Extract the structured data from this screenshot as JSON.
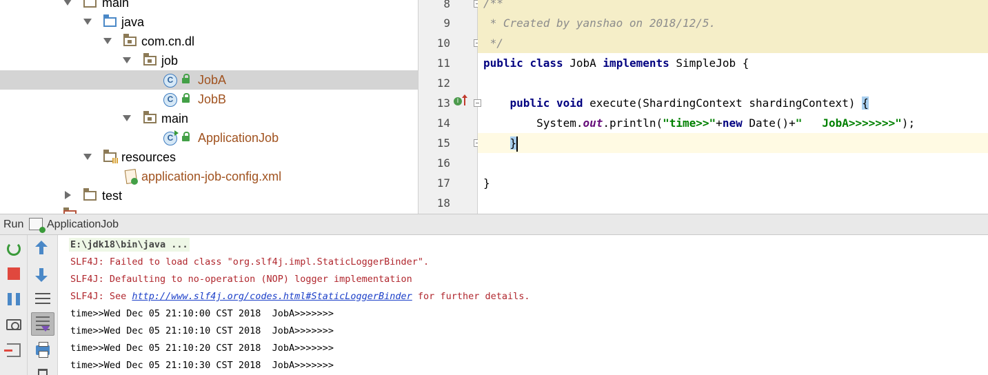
{
  "tree": {
    "items": [
      {
        "label": "main"
      },
      {
        "label": "java"
      },
      {
        "label": "com.cn.dl"
      },
      {
        "label": "job"
      },
      {
        "label": "JobA"
      },
      {
        "label": "JobB"
      },
      {
        "label": "main"
      },
      {
        "label": "ApplicationJob"
      },
      {
        "label": "resources"
      },
      {
        "label": "application-job-config.xml"
      },
      {
        "label": "test"
      }
    ],
    "class_icon_letter": "C"
  },
  "editor": {
    "line_numbers": [
      "8",
      "9",
      "10",
      "11",
      "12",
      "13",
      "14",
      "15",
      "16",
      "17",
      "18"
    ],
    "comment_open": "/**",
    "comment_text": " * Created by yanshao on 2018/12/5.",
    "comment_close": " */",
    "l11_kw1": "public",
    "l11_kw2": "class",
    "l11_name": "JobA",
    "l11_kw3": "implements",
    "l11_iface": "SimpleJob {",
    "l13_kw1": "public",
    "l13_kw2": "void",
    "l13_sig": "execute(ShardingContext shardingContext) ",
    "l13_brace": "{",
    "l14_a": "System.",
    "l14_out": "out",
    "l14_b": ".println(",
    "l14_str1": "\"time>>\"",
    "l14_plus1": "+",
    "l14_new": "new",
    "l14_c": " Date()+",
    "l14_str2": "\"   JobA>>>>>>>\"",
    "l14_end": ");",
    "l15_brace": "}",
    "l17_brace": "}",
    "override_icon": "I"
  },
  "run": {
    "title": "Run",
    "config_name": "ApplicationJob"
  },
  "console": {
    "cmd": "E:\\jdk18\\bin\\java ...",
    "err1": "SLF4J: Failed to load class \"org.slf4j.impl.StaticLoggerBinder\".",
    "err2": "SLF4J: Defaulting to no-operation (NOP) logger implementation",
    "err3_prefix": "SLF4J: See ",
    "err3_link": "http://www.slf4j.org/codes.html#StaticLoggerBinder",
    "err3_suffix": " for further details.",
    "out": [
      "time>>Wed Dec 05 21:10:00 CST 2018  JobA>>>>>>>",
      "time>>Wed Dec 05 21:10:10 CST 2018  JobA>>>>>>>",
      "time>>Wed Dec 05 21:10:20 CST 2018  JobA>>>>>>>",
      "time>>Wed Dec 05 21:10:30 CST 2018  JobA>>>>>>>"
    ]
  }
}
